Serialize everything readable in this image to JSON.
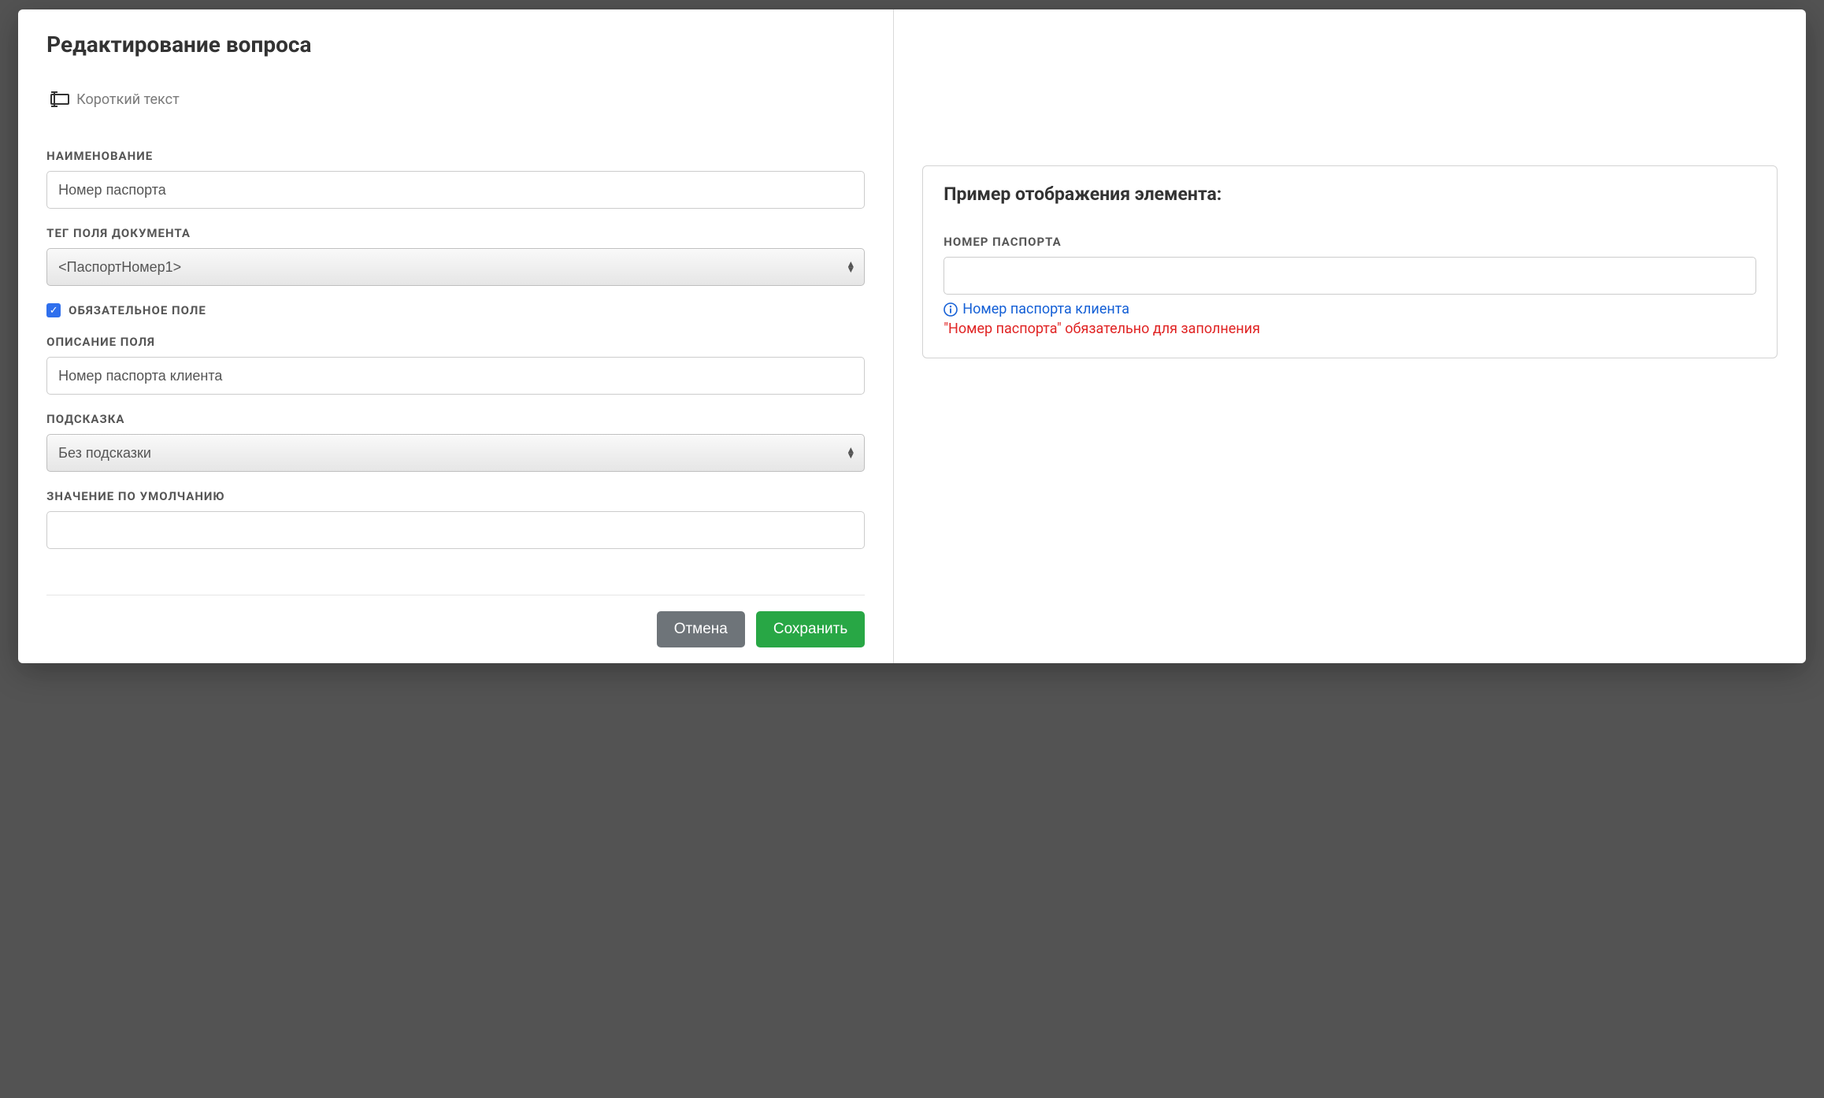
{
  "header": {
    "title": "Редактирование вопроса"
  },
  "type": {
    "icon": "short-text-icon",
    "label": "Короткий текст"
  },
  "form": {
    "name_label": "НАИМЕНОВАНИЕ",
    "name_value": "Номер паспорта",
    "tag_label": "ТЕГ ПОЛЯ ДОКУМЕНТА",
    "tag_value": "<ПаспортНомер1>",
    "required_label": "ОБЯЗАТЕЛЬНОЕ ПОЛЕ",
    "required_checked": true,
    "desc_label": "ОПИСАНИЕ ПОЛЯ",
    "desc_value": "Номер паспорта клиента",
    "hint_label": "ПОДСКАЗКА",
    "hint_value": "Без подсказки",
    "default_label": "ЗНАЧЕНИЕ ПО УМОЛЧАНИЮ",
    "default_value": ""
  },
  "footer": {
    "cancel": "Отмена",
    "save": "Сохранить"
  },
  "preview": {
    "title": "Пример отображения элемента:",
    "field_label": "НОМЕР ПАСПОРТА",
    "field_value": "",
    "hint_text": "Номер паспорта клиента",
    "error_text": "\"Номер паспорта\" обязательно для заполнения"
  }
}
